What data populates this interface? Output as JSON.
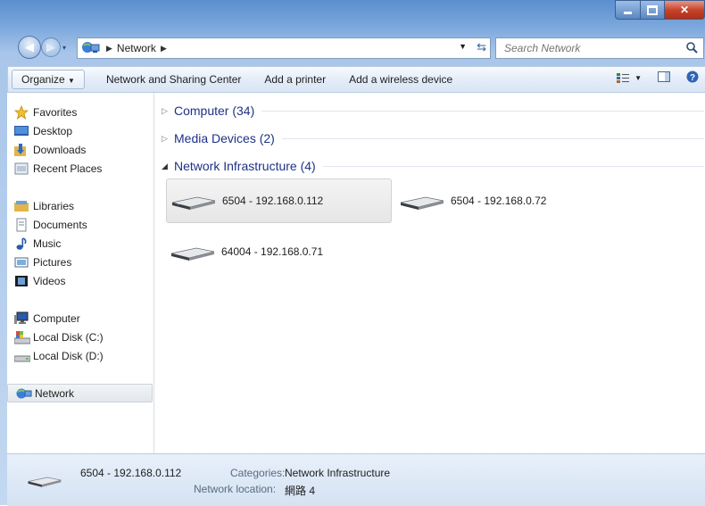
{
  "window": {
    "address_crumbs": [
      "Network"
    ],
    "search_placeholder": "Search Network"
  },
  "toolbar": {
    "organize": "Organize",
    "buttons": [
      "Network and Sharing Center",
      "Add a printer",
      "Add a wireless device"
    ]
  },
  "nav": {
    "favorites": "Favorites",
    "desktop": "Desktop",
    "downloads": "Downloads",
    "recent": "Recent Places",
    "libraries": "Libraries",
    "documents": "Documents",
    "music": "Music",
    "pictures": "Pictures",
    "videos": "Videos",
    "computer": "Computer",
    "disk_c": "Local Disk (C:)",
    "disk_d": "Local Disk (D:)",
    "network": "Network"
  },
  "groups": {
    "computer": "Computer (34)",
    "media": "Media Devices (2)",
    "infra": "Network Infrastructure (4)"
  },
  "devices": [
    "6504 - 192.168.0.112",
    "6504 - 192.168.0.72",
    "64004 - 192.168.0.71"
  ],
  "status": {
    "name": "6504 - 192.168.0.112",
    "categories_label": "Categories:",
    "categories_value": "Network Infrastructure",
    "location_label": "Network location:",
    "location_value": "網路 4"
  },
  "colors": {
    "accent": "#1e3287",
    "selection": "#e6e6e6",
    "close": "#c7452c"
  },
  "icons": [
    "back-icon",
    "forward-icon",
    "network-icon",
    "refresh-icon",
    "search-icon",
    "views-icon",
    "preview-pane-icon",
    "help-icon",
    "star-icon",
    "router-icon"
  ]
}
